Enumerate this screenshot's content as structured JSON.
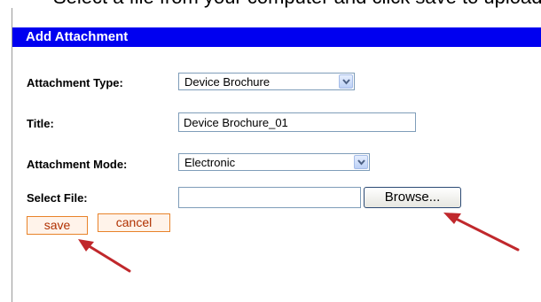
{
  "caption": {
    "text": "Select a file from your computer and click save to upload it"
  },
  "form": {
    "title": "Add Attachment",
    "attachment_type": {
      "label": "Attachment Type:",
      "value": "Device Brochure"
    },
    "title_field": {
      "label": "Title:",
      "value": "Device Brochure_01"
    },
    "attachment_mode": {
      "label": "Attachment Mode:",
      "value": "Electronic"
    },
    "select_file": {
      "label": "Select File:",
      "value": "",
      "browse_label": "Browse..."
    },
    "actions": {
      "save_label": "save",
      "cancel_label": "cancel"
    }
  },
  "colors": {
    "header_bg": "#0000f0",
    "button_border": "#e8832a",
    "button_text": "#b03000",
    "annotation_arrow": "#c0282c"
  },
  "icons": {
    "dropdown": "chevron-down-icon",
    "annotation": "red-arrow"
  }
}
